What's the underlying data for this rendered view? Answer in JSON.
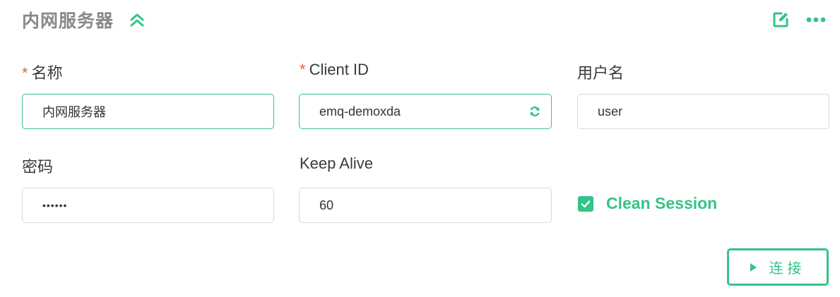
{
  "header": {
    "title": "内网服务器",
    "collapse_icon": "chevron-double-up-icon",
    "edit_icon": "edit-icon",
    "more_icon": "more-dots-icon"
  },
  "form": {
    "name": {
      "required_mark": "*",
      "label": "名称",
      "value": "内网服务器"
    },
    "client_id": {
      "required_mark": "*",
      "label": "Client ID",
      "value": "emq-demoxda",
      "refresh_icon": "refresh-icon"
    },
    "username": {
      "label": "用户名",
      "value": "user"
    },
    "password": {
      "label": "密码",
      "value": "••••••"
    },
    "keep_alive": {
      "label": "Keep Alive",
      "value": "60"
    },
    "clean_session": {
      "label": "Clean Session",
      "checked": true
    }
  },
  "connect_button": {
    "label": "连接",
    "icon": "play-icon"
  },
  "colors": {
    "accent": "#34c388",
    "required": "#e8604c",
    "title": "#888888"
  }
}
